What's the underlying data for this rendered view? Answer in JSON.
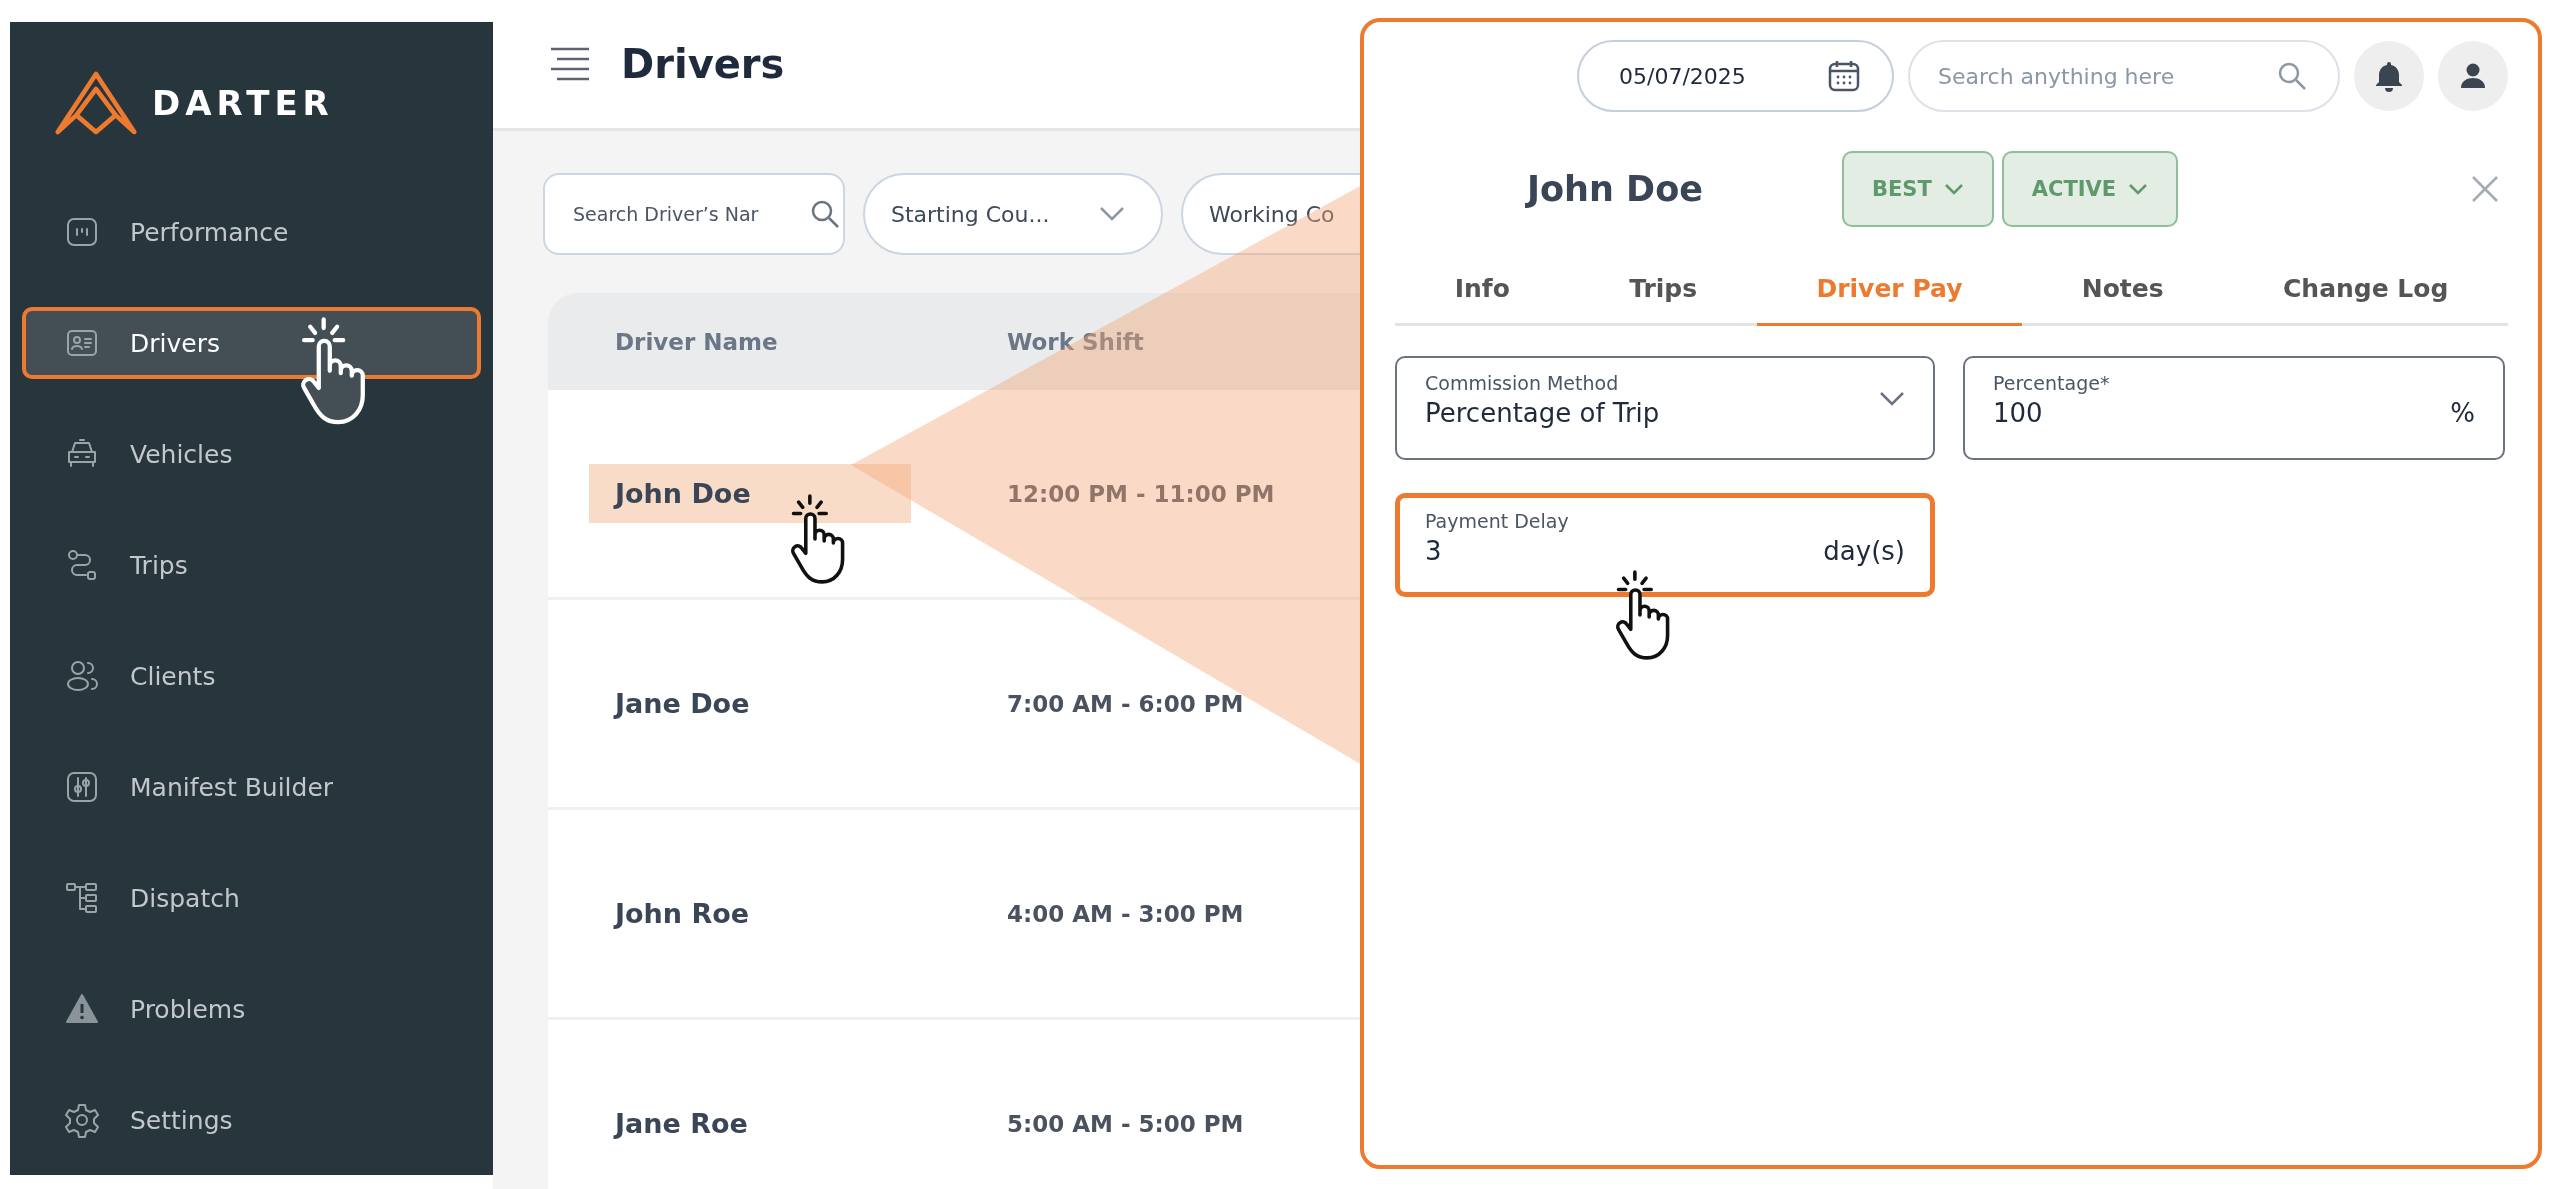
{
  "sidebar": {
    "logo": "DARTER",
    "items": [
      {
        "label": "Performance",
        "selected": false,
        "highlighted": false
      },
      {
        "label": "Drivers",
        "selected": true,
        "highlighted": true
      },
      {
        "label": "Vehicles",
        "selected": false,
        "highlighted": false
      },
      {
        "label": "Trips",
        "selected": false,
        "highlighted": false
      },
      {
        "label": "Clients",
        "selected": false,
        "highlighted": false
      },
      {
        "label": "Manifest Builder",
        "selected": false,
        "highlighted": false
      },
      {
        "label": "Dispatch",
        "selected": false,
        "highlighted": false
      },
      {
        "label": "Problems",
        "selected": false,
        "highlighted": false
      },
      {
        "label": "Settings",
        "selected": false,
        "highlighted": false
      }
    ]
  },
  "header": {
    "title": "Drivers"
  },
  "filters": {
    "search": {
      "placeholder": "Search Driver’s Nar"
    },
    "dropdowns": [
      {
        "label": "Starting Cou...",
        "chevron": true
      },
      {
        "label": "Working Co"
      }
    ]
  },
  "table": {
    "columns": [
      "Driver Name",
      "Work Shift"
    ],
    "rows": [
      {
        "name": "John Doe",
        "shift": "12:00 PM - 11:00 PM",
        "highlighted": true
      },
      {
        "name": "Jane Doe",
        "shift": "7:00 AM - 6:00 PM",
        "highlighted": false
      },
      {
        "name": "John Roe",
        "shift": "4:00 AM - 3:00 PM",
        "highlighted": false
      },
      {
        "name": "Jane Roe",
        "shift": "5:00 AM - 5:00 PM",
        "highlighted": false
      }
    ]
  },
  "panel": {
    "date": "05/07/2025",
    "search": {
      "placeholder": "Search anything here"
    },
    "driver_name": "John Doe",
    "badges": [
      "BEST",
      "ACTIVE"
    ],
    "tabs": [
      {
        "label": "Info",
        "selected": false
      },
      {
        "label": "Trips",
        "selected": false
      },
      {
        "label": "Driver Pay",
        "selected": true
      },
      {
        "label": "Notes",
        "selected": false
      },
      {
        "label": "Change Log",
        "selected": false
      }
    ],
    "fields": [
      {
        "kind": "select",
        "label": "Commission Method",
        "value": "Percentage of Trip",
        "highlighted": false
      },
      {
        "kind": "number",
        "label": "Percentage*",
        "value": "100",
        "suffix": "%",
        "highlighted": false
      },
      {
        "kind": "number",
        "label": "Payment Delay",
        "value": "3",
        "suffix": "day(s)",
        "highlighted": true
      }
    ]
  }
}
